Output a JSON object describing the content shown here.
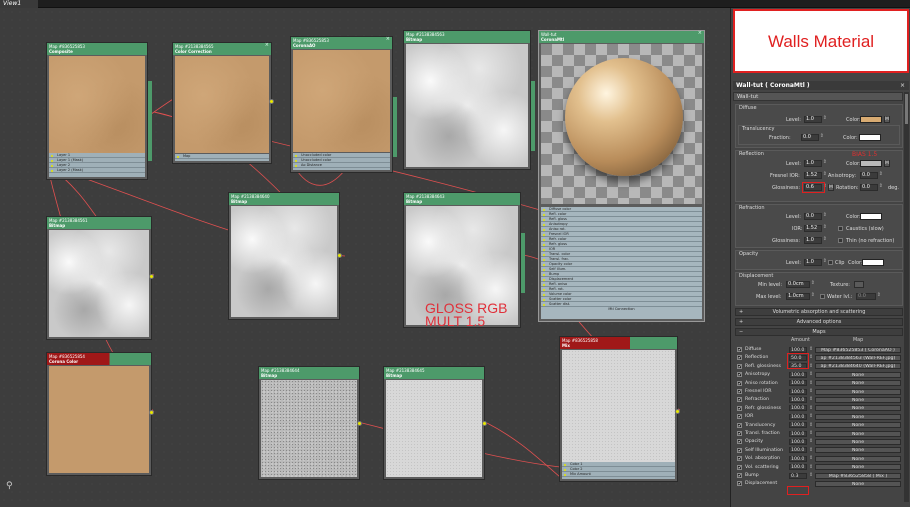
{
  "view_tab": "View1",
  "nodes": {
    "composite": {
      "id": "Map #836525853",
      "type": "Composite",
      "slots": [
        "Layer 1",
        "Layer 1 (Mask)",
        "Layer 2",
        "Layer 2 (Mask)"
      ]
    },
    "colorcorr": {
      "id": "Map #2138384565",
      "type": "Color Correction",
      "slots": [
        "Map"
      ]
    },
    "coronaao": {
      "id": "Map #836525853",
      "type": "CoronaAO",
      "slots": [
        "Unoccluded color",
        "Unoccluded color",
        "Ao Distance"
      ]
    },
    "bitmap_top": {
      "id": "Map #2138384563",
      "type": "Bitmap"
    },
    "bitmap_left": {
      "id": "Map #2138384561",
      "type": "Bitmap"
    },
    "bitmap_mid": {
      "id": "Map #2138384640",
      "type": "Bitmap"
    },
    "bitmap_mid2": {
      "id": "Map #2138384643",
      "type": "Bitmap"
    },
    "tan_red": {
      "id": "Map #836525854",
      "type": "Corona Color"
    },
    "bitmap_noise1": {
      "id": "Map #2138384644",
      "type": "Bitmap"
    },
    "bitmap_noise2": {
      "id": "Map #2138384645",
      "type": "Bitmap"
    },
    "mix_red": {
      "id": "Map #836525858",
      "type": "Mix",
      "slots": [
        "Color 1",
        "Color 2",
        "Mix Amount"
      ]
    },
    "material": {
      "id": "Wall-tut",
      "type": "CoronaMtl",
      "slots": [
        "Diffuse color",
        "Refl. color",
        "Refl. gloss",
        "Anisotropy",
        "Aniso rot.",
        "Fresnel IOR",
        "Refr. color",
        "Refr. gloss",
        "IOR",
        "Transl. color",
        "Transl. frac.",
        "Opacity color",
        "Self illum.",
        "Bump",
        "Displacement",
        "Refl. aniso",
        "Refl. rot.",
        "Volume color",
        "Scatter color",
        "Scatter dist."
      ],
      "bottom": "Mtl Connection"
    }
  },
  "gloss_note": "GLOSS RGB\nMULT 1.5",
  "panel": {
    "title_box": "Walls Material",
    "material_title": "Wall-tut  ( CoronaMtl )",
    "material_name": "Wall-tut",
    "diffuse": {
      "label": "Diffuse",
      "level_label": "Level:",
      "level": "1.0",
      "color_label": "Color:",
      "color": "#d8ab72",
      "m": "M"
    },
    "translucency": {
      "label": "Translucency",
      "fraction_label": "Fraction:",
      "fraction": "0.0",
      "color_label": "Color:",
      "color": "#ffffff"
    },
    "reflection": {
      "label": "Reflection",
      "note": "BIAS 1.5",
      "level_label": "Level:",
      "level": "1.0",
      "color_label": "Color:",
      "color": "#b9b9b9",
      "m": "M",
      "ior_label": "Fresnel IOR:",
      "ior": "1.52",
      "aniso_label": "Anisotropy:",
      "aniso": "0.0",
      "gloss_label": "Glossiness:",
      "gloss": "0.6",
      "rot_label": "Rotation:",
      "rot": "0.0",
      "deg": "deg."
    },
    "refraction": {
      "label": "Refraction",
      "level_label": "Level:",
      "level": "0.0",
      "color_label": "Color:",
      "color": "#ffffff",
      "ior_label": "IOR:",
      "ior": "1.52",
      "caustics": "Caustics (slow)",
      "gloss_label": "Glossiness:",
      "gloss": "1.0",
      "thin": "Thin (no refraction)"
    },
    "opacity": {
      "label": "Opacity",
      "level_label": "Level:",
      "level": "1.0",
      "clip": "Clip",
      "color_label": "Color:",
      "color": "#ffffff"
    },
    "displacement": {
      "label": "Displacement",
      "min_label": "Min level:",
      "min": "0.0cm",
      "texture_label": "Texture:",
      "max_label": "Max level:",
      "max": "1.0cm",
      "water": "Water lvl.:",
      "water_val": "0.0"
    },
    "rollouts": [
      "Volumetric absorption and scattering",
      "Advanced options",
      "Maps"
    ],
    "maps_head": {
      "amount": "Amount",
      "map": "Map"
    },
    "maps": [
      {
        "name": "Diffuse",
        "amount": "100.0",
        "map": "Map #836525853 ( CoronaAO )"
      },
      {
        "name": "Reflection",
        "amount": "50.0",
        "map": "ap #2138384563 (Wall-REF.jpg)"
      },
      {
        "name": "Refl. glossiness",
        "amount": "35.0",
        "map": "ap #2138384640 (Wall-REF.jpg)"
      },
      {
        "name": "Anisotropy",
        "amount": "100.0",
        "map": "None"
      },
      {
        "name": "Aniso rotation",
        "amount": "100.0",
        "map": "None"
      },
      {
        "name": "Fresnel IOR",
        "amount": "100.0",
        "map": "None"
      },
      {
        "name": "Refraction",
        "amount": "100.0",
        "map": "None"
      },
      {
        "name": "Refr. glossiness",
        "amount": "100.0",
        "map": "None"
      },
      {
        "name": "IOR",
        "amount": "100.0",
        "map": "None"
      },
      {
        "name": "Translucency",
        "amount": "100.0",
        "map": "None"
      },
      {
        "name": "Transl. fraction",
        "amount": "100.0",
        "map": "None"
      },
      {
        "name": "Opacity",
        "amount": "100.0",
        "map": "None"
      },
      {
        "name": "Self Illumination",
        "amount": "100.0",
        "map": "None"
      },
      {
        "name": "Vol. absorption",
        "amount": "100.0",
        "map": "None"
      },
      {
        "name": "Vol. scattering",
        "amount": "100.0",
        "map": "None"
      },
      {
        "name": "Bump",
        "amount": "0.3",
        "map": "Map #836525858  ( Mix )"
      },
      {
        "name": "Displacement",
        "amount": "",
        "map": "None"
      }
    ]
  }
}
